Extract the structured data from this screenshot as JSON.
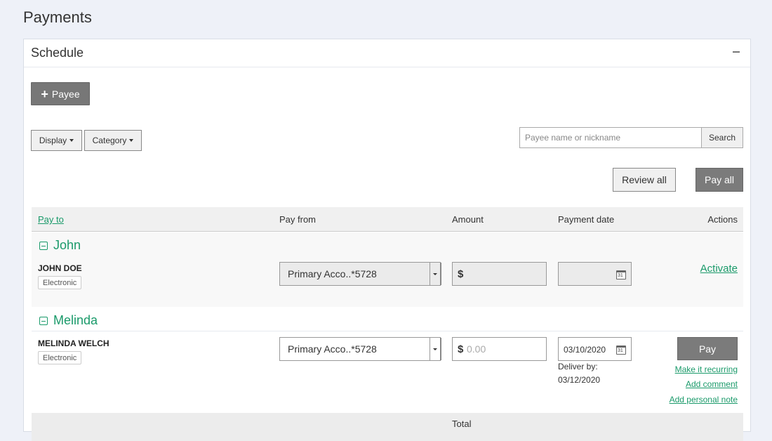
{
  "page": {
    "title": "Payments"
  },
  "panel": {
    "title": "Schedule",
    "collapse_icon": "minus-icon"
  },
  "toolbar": {
    "add_payee_label": "Payee",
    "display_label": "Display",
    "category_label": "Category",
    "search_placeholder": "Payee name or nickname",
    "search_button": "Search",
    "review_all": "Review all",
    "pay_all": "Pay all"
  },
  "table": {
    "columns": {
      "pay_to": "Pay to",
      "pay_from": "Pay from",
      "amount": "Amount",
      "payment_date": "Payment date",
      "actions": "Actions"
    }
  },
  "groups": [
    {
      "name": "John",
      "payee": {
        "name": "JOHN DOE",
        "type": "Electronic",
        "account": "Primary Acco..*5728",
        "amount_placeholder": "",
        "date": "",
        "action": "Activate"
      }
    },
    {
      "name": "Melinda",
      "payee": {
        "name": "MELINDA WELCH",
        "type": "Electronic",
        "account": "Primary Acco..*5728",
        "amount_placeholder": "0.00",
        "date": "03/10/2020",
        "deliver_label": "Deliver by:",
        "deliver_date": "03/12/2020",
        "pay_button": "Pay",
        "links": [
          "Make it recurring",
          "Add comment",
          "Add personal note"
        ]
      }
    }
  ],
  "footer": {
    "total_label": "Total"
  },
  "colors": {
    "accent": "#1a9a6a",
    "button_dark": "#7b7b7b",
    "background": "#eef1f8"
  }
}
